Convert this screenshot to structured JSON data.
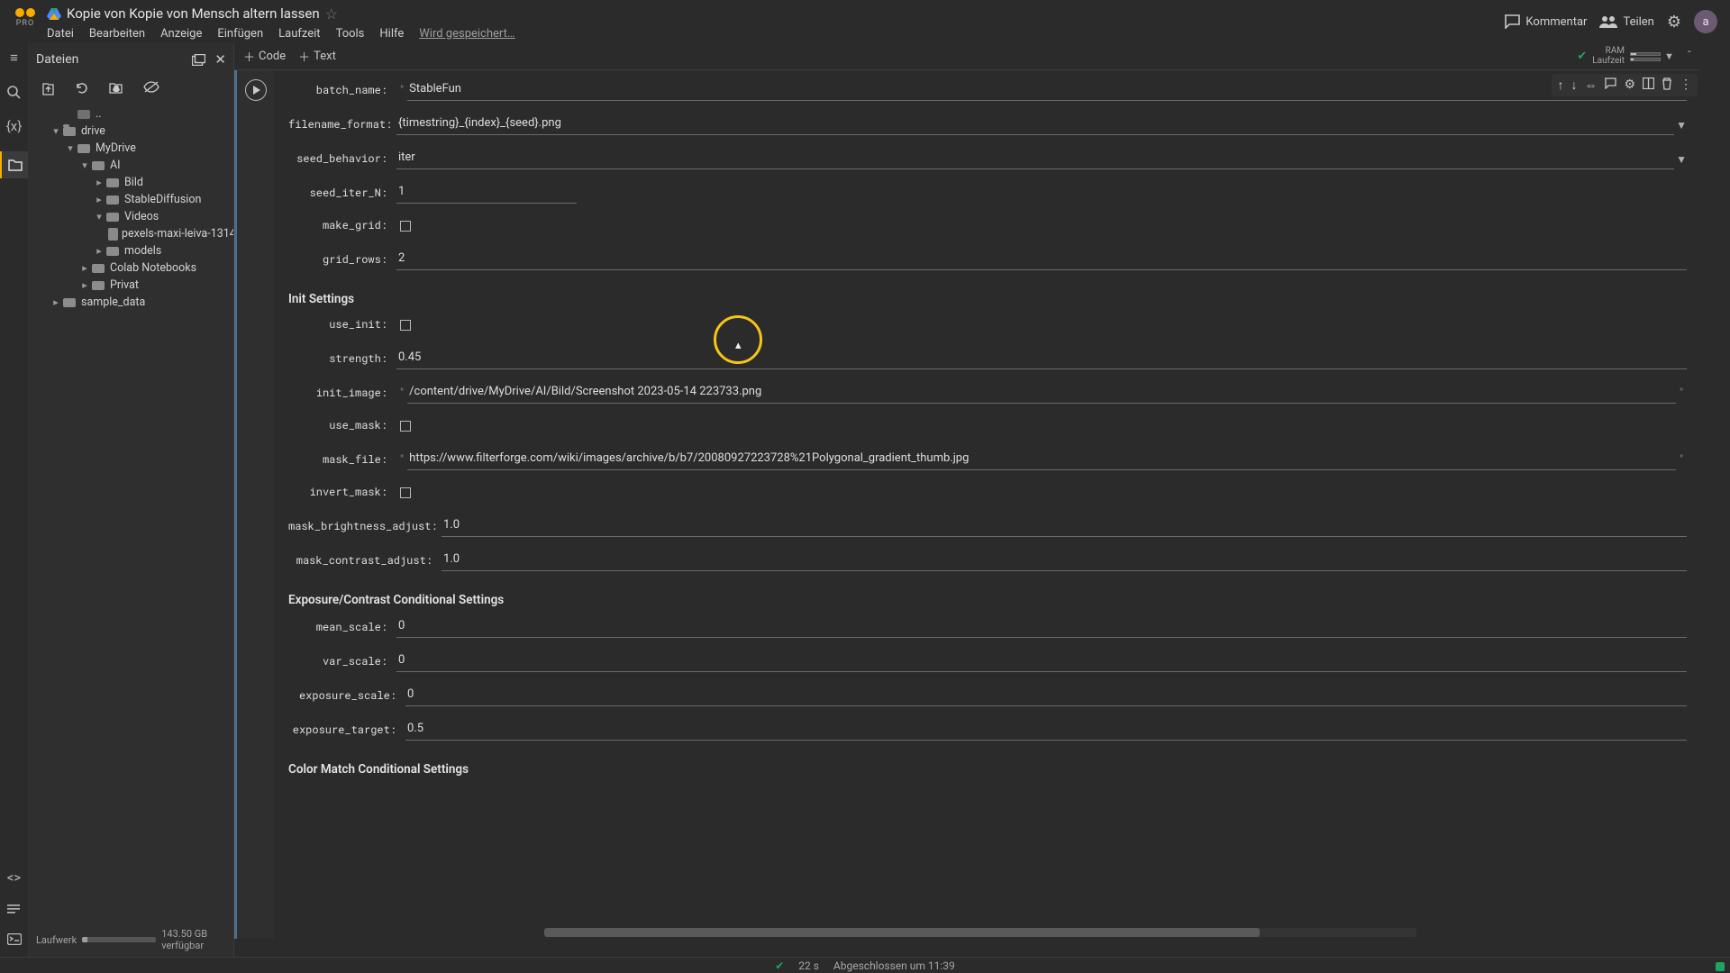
{
  "header": {
    "pro": "PRO",
    "doc_title": "Kopie von Kopie von Mensch altern lassen",
    "menus": [
      "Datei",
      "Bearbeiten",
      "Anzeige",
      "Einfügen",
      "Laufzeit",
      "Tools",
      "Hilfe"
    ],
    "save_status": "Wird gespeichert…",
    "comment": "Kommentar",
    "share": "Teilen",
    "avatar": "a"
  },
  "toolbar": {
    "code": "Code",
    "text": "Text",
    "ram": "RAM",
    "runtime": "Laufzeit"
  },
  "files": {
    "title": "Dateien",
    "root_dots": "..",
    "drive": "drive",
    "mydrive": "MyDrive",
    "ai": "AI",
    "bild": "Bild",
    "sd": "StableDiffusion",
    "videos": "Videos",
    "video_file": "pexels-maxi-leiva-1314…",
    "models": "models",
    "colabnb": "Colab Notebooks",
    "privat": "Privat",
    "sample": "sample_data",
    "storage_label": "Laufwerk",
    "storage_free": "143.50 GB verfügbar"
  },
  "form": {
    "batch_name": {
      "label": "batch_name:",
      "value": "StableFun"
    },
    "filename_format": {
      "label": "filename_format:",
      "value": "{timestring}_{index}_{seed}.png"
    },
    "seed_behavior": {
      "label": "seed_behavior:",
      "value": "iter"
    },
    "seed_iter_n": {
      "label": "seed_iter_N:",
      "value": "1"
    },
    "make_grid": {
      "label": "make_grid:"
    },
    "grid_rows": {
      "label": "grid_rows:",
      "value": "2"
    },
    "sect_init": "Init Settings",
    "use_init": {
      "label": "use_init:"
    },
    "strength": {
      "label": "strength:",
      "value": "0.45"
    },
    "init_image": {
      "label": "init_image:",
      "value": "/content/drive/MyDrive/AI/Bild/Screenshot 2023-05-14 223733.png"
    },
    "use_mask": {
      "label": "use_mask:"
    },
    "mask_file": {
      "label": "mask_file:",
      "value": "https://www.filterforge.com/wiki/images/archive/b/b7/20080927223728%21Polygonal_gradient_thumb.jpg"
    },
    "invert_mask": {
      "label": "invert_mask:"
    },
    "mask_brightness": {
      "label": "mask_brightness_adjust:",
      "value": "1.0"
    },
    "mask_contrast": {
      "label": "mask_contrast_adjust:",
      "value": "1.0"
    },
    "sect_exposure": "Exposure/Contrast Conditional Settings",
    "mean_scale": {
      "label": "mean_scale:",
      "value": "0"
    },
    "var_scale": {
      "label": "var_scale:",
      "value": "0"
    },
    "exposure_scale": {
      "label": "exposure_scale:",
      "value": "0"
    },
    "exposure_target": {
      "label": "exposure_target:",
      "value": "0.5"
    },
    "sect_color": "Color Match Conditional Settings"
  },
  "footer": {
    "elapsed": "22 s",
    "done": "Abgeschlossen um 11:39"
  }
}
